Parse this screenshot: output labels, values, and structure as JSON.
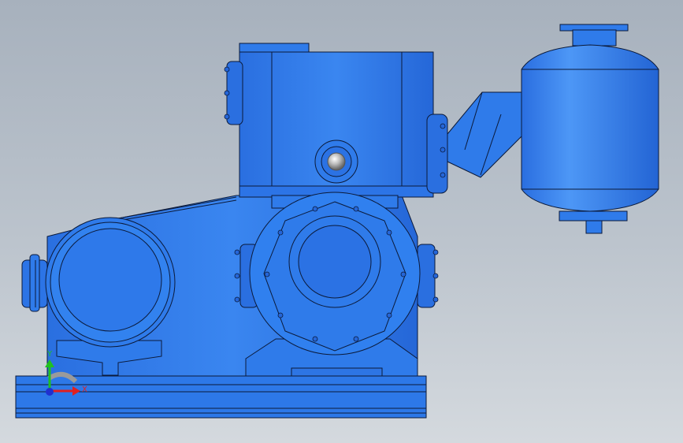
{
  "viewport": {
    "background_top": "#a7b1bd",
    "background_bottom": "#d4d9de"
  },
  "model": {
    "body_color": "#2f7bea",
    "shade_color": "#1f5fd0",
    "highlight_color": "#4c95f5",
    "edge_color": "#0b1a3a",
    "sight_glass_color": "#c9c9c9"
  },
  "triad": {
    "x_label": "X",
    "y_label": "Y",
    "x_color": "#e02020",
    "y_color": "#20c020",
    "z_color": "#2030d0"
  }
}
